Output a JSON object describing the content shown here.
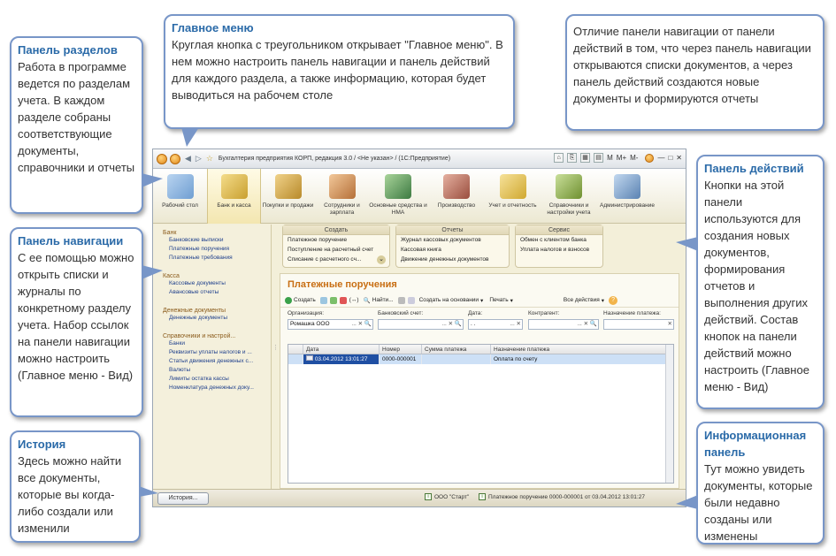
{
  "callouts": {
    "main_menu": {
      "title": "Главное меню",
      "body": "Круглая кнопка с треугольником открывает \"Главное меню\". В нем можно настроить панель навигации и панель действий для каждого раздела, а также информацию, которая будет выводиться на рабочем столе"
    },
    "difference": {
      "body": "Отличие панели навигации от панели действий в том, что через панель навигации открываются списки документов, а через панель действий создаются новые документы и формируются отчеты"
    },
    "sections_panel": {
      "title": "Панель разделов",
      "body": "Работа в программе ведется по разделам учета. В каждом разделе собраны соответствующие документы, справочники и отчеты"
    },
    "nav_panel": {
      "title": "Панель навигации",
      "body": "С ее помощью можно открыть списки и журналы по конкретному разделу учета. Набор ссылок на панели навигации можно настроить (Главное меню - Вид)"
    },
    "history": {
      "title": "История",
      "body": "Здесь можно найти все документы, которые вы когда-либо создали или изменили"
    },
    "actions_panel": {
      "title": "Панель действий",
      "body": "Кнопки на этой панели используются для создания новых документов, формирования отчетов и выполнения других действий. Состав кнопок на панели действий можно настроить (Главное меню - Вид)"
    },
    "info_panel": {
      "title": "Информационная панель",
      "body": "Тут можно увидеть документы, которые были недавно созданы или изменены"
    }
  },
  "window": {
    "title": "Бухгалтерия предприятия КОРП, редакция 3.0 / <Не указан> / (1С:Предприятие)",
    "right_buttons": [
      "M",
      "M+",
      "M-"
    ]
  },
  "sections": [
    {
      "label": "Рабочий стол",
      "color": "#7aa7d9"
    },
    {
      "label": "Банк и касса",
      "color": "#d9b44a"
    },
    {
      "label": "Покупки и продажи",
      "color": "#c9a030"
    },
    {
      "label": "Сотрудники и зарплата",
      "color": "#d08a4a"
    },
    {
      "label": "Основные средства и НМА",
      "color": "#4f9a55"
    },
    {
      "label": "Производство",
      "color": "#b86a5a"
    },
    {
      "label": "Учет и отчетность",
      "color": "#e0bc50"
    },
    {
      "label": "Справочники и настройки учета",
      "color": "#8aa84a"
    },
    {
      "label": "Администрирование",
      "color": "#6a90c0"
    }
  ],
  "nav": [
    {
      "group": "Банк",
      "links": [
        "Банковские выписки",
        "Платежные поручения",
        "Платежные требования"
      ]
    },
    {
      "group": "Касса",
      "links": [
        "Кассовые документы",
        "Авансовые отчеты"
      ]
    },
    {
      "group": "Денежные документы",
      "links": [
        "Денежные документы"
      ]
    },
    {
      "group": "Справочники и настрой...",
      "links": [
        "Банки",
        "Реквизиты уплаты налогов и ...",
        "Статьи движения денежных с...",
        "Валюты",
        "Лимиты остатка кассы",
        "Номенклатура денежных доку..."
      ]
    }
  ],
  "actions": {
    "create": {
      "title": "Создать",
      "items": [
        "Платежное поручение",
        "Поступление на расчетный счет",
        "Списание с расчетного сч..."
      ]
    },
    "reports": {
      "title": "Отчеты",
      "items": [
        "Журнал кассовых документов",
        "Кассовая книга",
        "Движение денежных документов"
      ]
    },
    "service": {
      "title": "Сервис",
      "items": [
        "Обмен с клиентом банка",
        "Уплата налогов и взносов"
      ]
    }
  },
  "content": {
    "title": "Платежные поручения",
    "toolbar": {
      "create": "Создать",
      "find": "Найти...",
      "create_based": "Создать на основании",
      "print": "Печать",
      "all_actions": "Все действия"
    },
    "filters": {
      "org_label": "Организация:",
      "org_value": "Ромашка ООО",
      "bank_label": "Банковский счет:",
      "date_label": "Дата:",
      "date_value": ". .",
      "contractor_label": "Контрагент:",
      "purpose_label": "Назначение платежа:"
    },
    "columns": [
      "Дата",
      "Номер",
      "Сумма платежа",
      "Назначение платежа"
    ],
    "rows": [
      {
        "date": "03.04.2012 13:01:27",
        "number": "0000-000001",
        "sum": "",
        "purpose": "Оплата по счету"
      }
    ]
  },
  "statusbar": {
    "history": "История...",
    "org": "ООО \"Старт\"",
    "recent": "Платежное поручение 0000-000001 от 03.04.2012 13:01:27"
  }
}
